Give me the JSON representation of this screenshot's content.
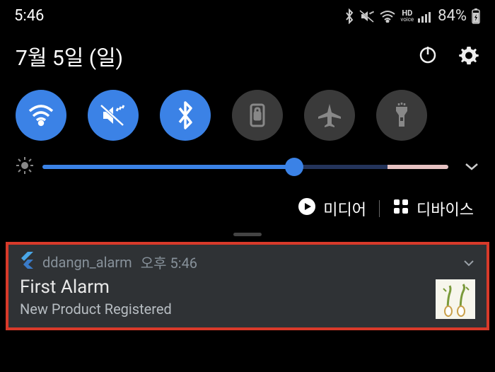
{
  "status": {
    "time": "5:46",
    "battery": "84%"
  },
  "date": "7월 5일 (일)",
  "brightness": {
    "value": 62
  },
  "quick": {
    "media": "미디어",
    "device": "디바이스"
  },
  "notification": {
    "app": "ddangn_alarm",
    "time": "오후 5:46",
    "title": "First Alarm",
    "body": "New Product Registered"
  }
}
